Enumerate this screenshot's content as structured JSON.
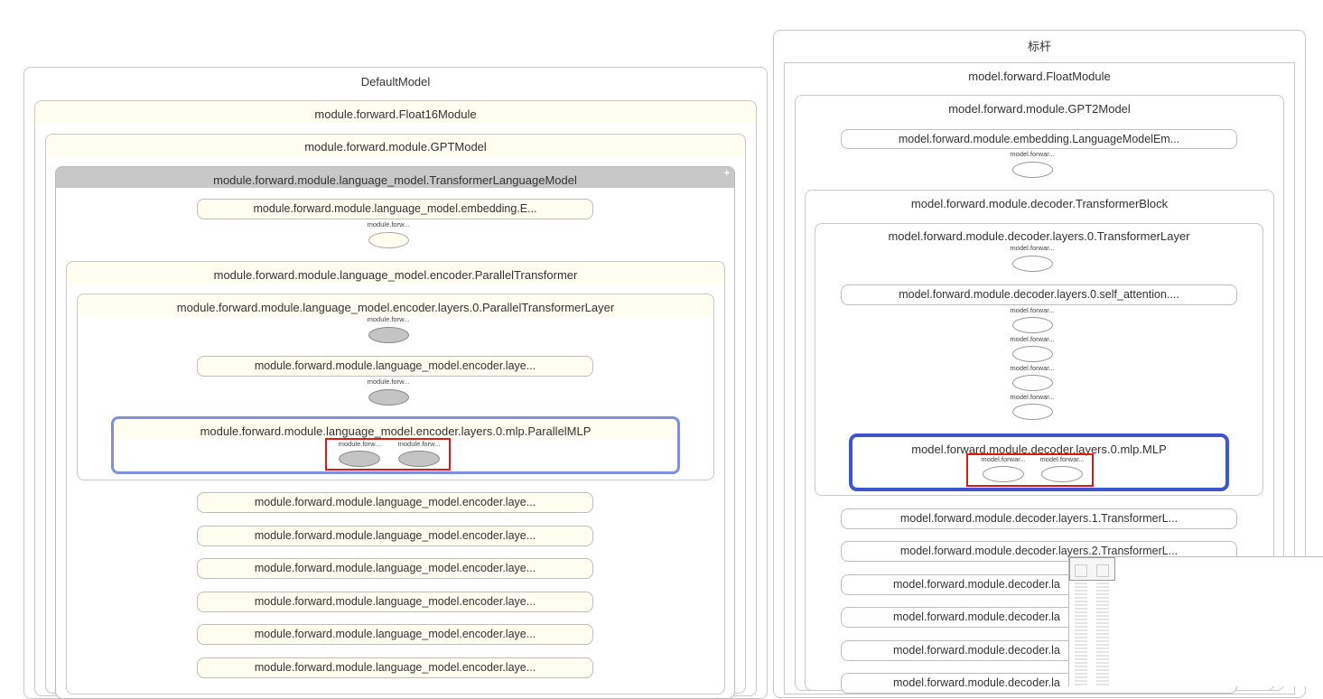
{
  "left_panel": {
    "title": "DefaultModel",
    "float16": "module.forward.Float16Module",
    "gpt": "module.forward.module.GPTModel",
    "lang_model": "module.forward.module.language_model.TransformerLanguageModel",
    "embedding": "module.forward.module.language_model.embedding.E...",
    "embedding_node": "module.forw...",
    "parallel_transformer": "module.forward.module.language_model.encoder.ParallelTransformer",
    "layer0": "module.forward.module.language_model.encoder.layers.0.ParallelTransformerLayer",
    "layer0_node": "module.forw...",
    "encoder_laye_a": "module.forward.module.language_model.encoder.laye...",
    "encoder_laye_a_node": "module.forw...",
    "mlp": "module.forward.module.language_model.encoder.layers.0.mlp.ParallelMLP",
    "mlp_node_1": "module.forw...",
    "mlp_node_2": "module.forw...",
    "encoder_layers": [
      "module.forward.module.language_model.encoder.laye...",
      "module.forward.module.language_model.encoder.laye...",
      "module.forward.module.language_model.encoder.laye...",
      "module.forward.module.language_model.encoder.laye...",
      "module.forward.module.language_model.encoder.laye...",
      "module.forward.module.language_model.encoder.laye..."
    ],
    "expand_symbol": "+"
  },
  "right_panel": {
    "title": "标杆",
    "float_module": "model.forward.FloatModule",
    "gpt2": "model.forward.module.GPT2Model",
    "embedding": "model.forward.module.embedding.LanguageModelEm...",
    "embedding_node": "model.forwar...",
    "transformer_block": "model.forward.module.decoder.TransformerBlock",
    "layer0": "model.forward.module.decoder.layers.0.TransformerLayer",
    "layer0_node": "model.forwar...",
    "self_attention": "model.forward.module.decoder.layers.0.self_attention....",
    "attention_nodes": [
      "model.forwar...",
      "model.forwar...",
      "model.forwar...",
      "model.forwar..."
    ],
    "mlp": "model.forward.module.decoder.layers.0.mlp.MLP",
    "mlp_node_1": "model.forwar...",
    "mlp_node_2": "model.forwar...",
    "decoder_layers": [
      "model.forward.module.decoder.layers.1.TransformerL...",
      "model.forward.module.decoder.layers.2.TransformerL...",
      "model.forward.module.decoder.la",
      "model.forward.module.decoder.la",
      "model.forward.module.decoder.la",
      "model.forward.module.decoder.la"
    ]
  },
  "colors": {
    "highlight_blue_left": "#7f8fdc",
    "highlight_blue_right": "#3e55cc",
    "highlight_red": "#d71a1a",
    "cream": "#fffcf0",
    "node_gray": "#c4c4c4"
  }
}
